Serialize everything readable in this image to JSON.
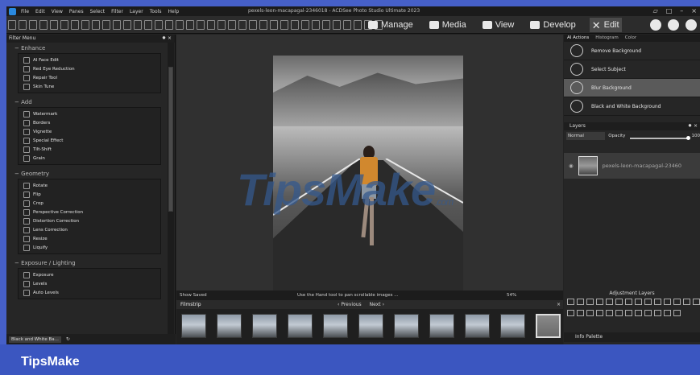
{
  "window": {
    "title": "pexels-leon-macapagal-2346018 - ACDSee Photo Studio Ultimate 2023",
    "menu": [
      "File",
      "Edit",
      "View",
      "Panes",
      "Select",
      "Filter",
      "Layer",
      "Tools",
      "Help"
    ],
    "controls": [
      "▱",
      "□",
      "–",
      "×"
    ]
  },
  "toolbar": {
    "modes": [
      {
        "label": "Manage",
        "icon": "grid-icon"
      },
      {
        "label": "Media",
        "icon": "media-icon"
      },
      {
        "label": "View",
        "icon": "eye-icon"
      },
      {
        "label": "Develop",
        "icon": "develop-icon"
      },
      {
        "label": "Edit",
        "icon": "edit-icon",
        "active": true
      }
    ]
  },
  "filter_menu": {
    "title": "Filter Menu",
    "pin": "✸ ×",
    "groups": [
      {
        "title": "Enhance",
        "items": [
          "AI Face Edit",
          "Red Eye Reduction",
          "Repair Tool",
          "Skin Tune"
        ]
      },
      {
        "title": "Add",
        "items": [
          "Watermark",
          "Borders",
          "Vignette",
          "Special Effect",
          "Tilt-Shift",
          "Grain"
        ]
      },
      {
        "title": "Geometry",
        "items": [
          "Rotate",
          "Flip",
          "Crop",
          "Perspective Correction",
          "Distortion Correction",
          "Lens Correction",
          "Resize",
          "Liquify"
        ]
      },
      {
        "title": "Exposure / Lighting",
        "items": [
          "Exposure",
          "Levels",
          "Auto Levels"
        ]
      }
    ],
    "bottom_label": "Black and White Ba..."
  },
  "canvas": {
    "watermark": "TipsMake",
    "watermark_suffix": ".com"
  },
  "statusbar": {
    "show_saved": "Show Saved",
    "hint": "Use the Hand tool to pan scrollable images ...",
    "zoom": "54%"
  },
  "filmstrip": {
    "title": "Filmstrip",
    "prev": "Previous",
    "next": "Next",
    "close": "×",
    "thumb_count": 11,
    "selected_index": 10
  },
  "right_panel": {
    "tabs": [
      "AI Actions",
      "Histogram",
      "Color"
    ],
    "ai_actions": [
      "Remove Background",
      "Select Subject",
      "Blur Background",
      "Black and White Background"
    ],
    "selected_ai_action": 2,
    "layers": {
      "title": "Layers",
      "blend_mode": "Normal",
      "opacity_label": "Opacity",
      "opacity_value": "100",
      "layer_name": "pexels-leon-macapagal-23460"
    },
    "adjustment_layers": "Adjustment Layers",
    "info_palette": "Info Palette"
  },
  "footer": {
    "brand": "TipsMake"
  },
  "colors": {
    "frame": "#4660c8",
    "app_bg": "#232323",
    "accent_selected": "#5a5a5a",
    "watermark": "#34588c"
  }
}
